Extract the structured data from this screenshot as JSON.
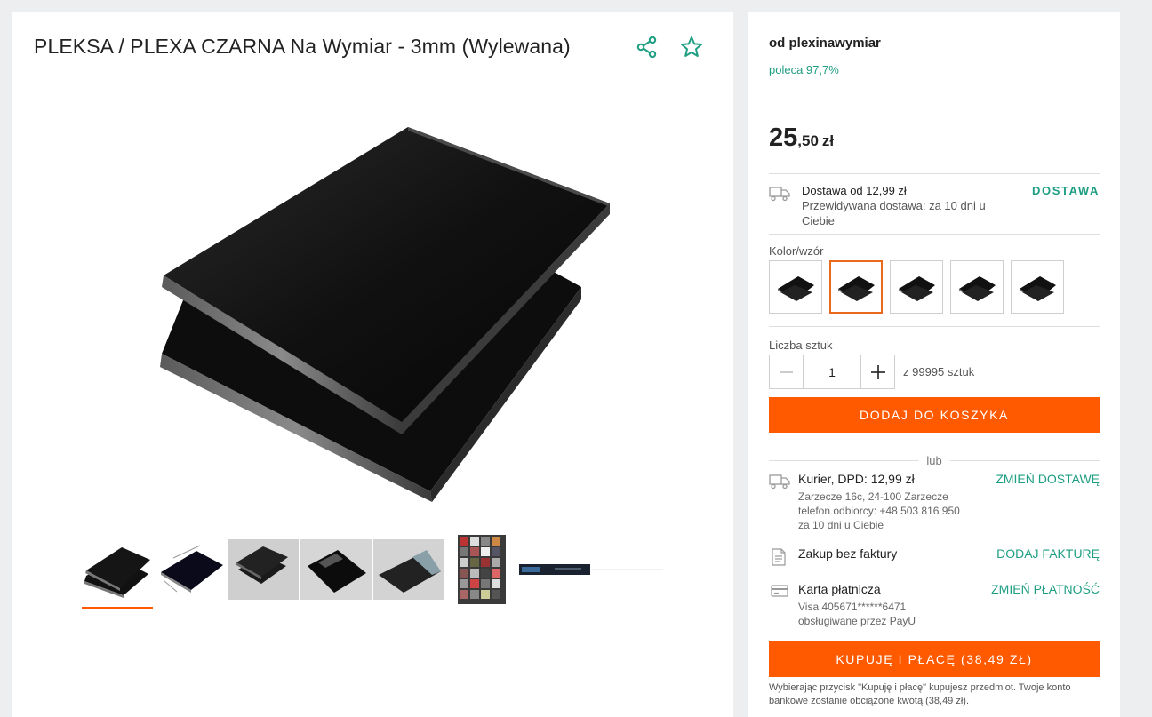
{
  "product": {
    "title": "PLEKSA / PLEXA CZARNA Na Wymiar - 3mm (Wylewana)"
  },
  "icons": {
    "share": "share-icon",
    "favorite": "star-icon",
    "delivery": "truck-icon",
    "invoice": "document-icon",
    "card": "credit-card-icon"
  },
  "seller": {
    "name": "od plexinawymiar",
    "rating": "poleca 97,7%"
  },
  "price": {
    "integer": "25",
    "fraction": ",50",
    "currency": "zł"
  },
  "delivery": {
    "main": "Dostawa od 12,99 zł",
    "sub": "Przewidywana dostawa: za 10 dni u Ciebie",
    "link": "DOSTAWA"
  },
  "variants": {
    "label": "Kolor/wzór",
    "selected_index": 1
  },
  "quantity": {
    "label": "Liczba sztuk",
    "value": "1",
    "of_text": "z 99995 sztuk"
  },
  "buttons": {
    "add_to_cart": "DODAJ DO KOSZYKA",
    "buy_and_pay": "KUPUJĘ I PŁACĘ (38,49 ZŁ)"
  },
  "or_text": "lub",
  "shipping": {
    "main": "Kurier, DPD: 12,99 zł",
    "address": "Zarzecze 16c, 24-100 Zarzecze",
    "phone": "telefon odbiorcy: +48 503 816 950",
    "eta": "za 10 dni u Ciebie",
    "link": "ZMIEŃ DOSTAWĘ"
  },
  "invoice": {
    "main": "Zakup bez faktury",
    "link": "DODAJ FAKTURĘ"
  },
  "payment": {
    "main": "Karta płatnicza",
    "card_number": "Visa 405671******6471",
    "provider": "obsługiwane przez PayU",
    "link": "ZMIEŃ PŁATNOŚĆ"
  },
  "disclaimer": "Wybierając przycisk \"Kupuję i płacę\" kupujesz przedmiot. Twoje konto bankowe zostanie obciążone kwotą (38,49 zł).",
  "colors": {
    "accent_green": "#1e9e82",
    "accent_orange": "#ff5a00",
    "selected_border": "#e86a1a"
  }
}
